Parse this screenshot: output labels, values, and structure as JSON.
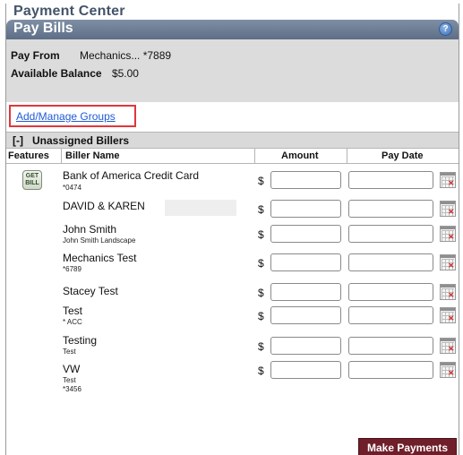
{
  "header": {
    "title": "Payment Center"
  },
  "panel": {
    "title": "Pay Bills",
    "help_label": "?"
  },
  "account": {
    "pay_from_label": "Pay From",
    "pay_from_value": "Mechanics... *7889",
    "balance_label": "Available Balance",
    "balance_value": "$5.00"
  },
  "groups_link": "Add/Manage Groups",
  "section": {
    "toggle": "[-]",
    "name": "Unassigned Billers"
  },
  "columns": {
    "features": "Features",
    "biller": "Biller Name",
    "amount": "Amount",
    "pay_date": "Pay Date"
  },
  "currency_symbol": "$",
  "billers": [
    {
      "name": "Bank of America Credit Card",
      "sub1": "*0474",
      "sub2": "",
      "feature": "GET BILL"
    },
    {
      "name": "DAVID & KAREN",
      "sub1": "",
      "sub2": "",
      "feature": ""
    },
    {
      "name": "John Smith",
      "sub1": "John Smith Landscape",
      "sub2": "",
      "feature": ""
    },
    {
      "name": "Mechanics Test",
      "sub1": "*6789",
      "sub2": "",
      "feature": ""
    },
    {
      "name": "Stacey Test",
      "sub1": "",
      "sub2": "",
      "feature": ""
    },
    {
      "name": "Test",
      "sub1": "* ACC",
      "sub2": "",
      "feature": ""
    },
    {
      "name": "Testing",
      "sub1": "Test",
      "sub2": "",
      "feature": ""
    },
    {
      "name": "VW",
      "sub1": "Test",
      "sub2": "*3456",
      "feature": ""
    }
  ],
  "make_payments_label": "Make Payments",
  "icons": {
    "help": "help-icon",
    "calendar": "calendar-icon",
    "get_bill": "get-bill-icon"
  },
  "colors": {
    "panel_header": "#5d6e86",
    "title_text": "#44546a",
    "button": "#6f1f2a",
    "highlight": "#e0373b",
    "link": "#1f5bd6"
  }
}
